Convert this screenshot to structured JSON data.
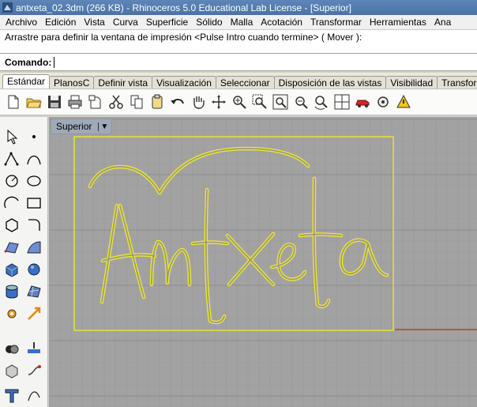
{
  "window": {
    "title": "antxeta_02.3dm (266 KB) - Rhinoceros 5.0 Educational Lab License - [Superior]"
  },
  "menu": [
    "Archivo",
    "Edición",
    "Vista",
    "Curva",
    "Superficie",
    "Sólido",
    "Malla",
    "Acotación",
    "Transformar",
    "Herramientas",
    "Ana"
  ],
  "history": {
    "text": "Arrastre para definir la ventana de impresión <Pulse Intro cuando termine> ( Mover ):"
  },
  "command": {
    "label": "Comando:",
    "value": ""
  },
  "tabs": [
    {
      "label": "Estándar",
      "active": true
    },
    {
      "label": "PlanosC"
    },
    {
      "label": "Definir vista"
    },
    {
      "label": "Visualización"
    },
    {
      "label": "Seleccionar"
    },
    {
      "label": "Disposición de las vistas"
    },
    {
      "label": "Visibilidad"
    },
    {
      "label": "Transfor"
    }
  ],
  "viewport": {
    "name": "Superior",
    "drawing_text": "Antxeta"
  },
  "colors": {
    "curve": "#f2ea2e",
    "grid_bg": "#a2a2a2",
    "x_axis": "#b04040"
  },
  "toolbar_icons": [
    "new-file-icon",
    "open-folder-icon",
    "save-icon",
    "print-icon",
    "import-icon",
    "cut-icon",
    "copy-icon",
    "paste-icon",
    "undo-icon",
    "pan-hand-icon",
    "rotate-view-icon",
    "zoom-icon",
    "zoom-window-icon",
    "zoom-extents-icon",
    "zoom-selected-icon",
    "rotate-camera-icon",
    "four-viewports-icon",
    "car-render-icon",
    "options-icon",
    "analyze-icon"
  ]
}
